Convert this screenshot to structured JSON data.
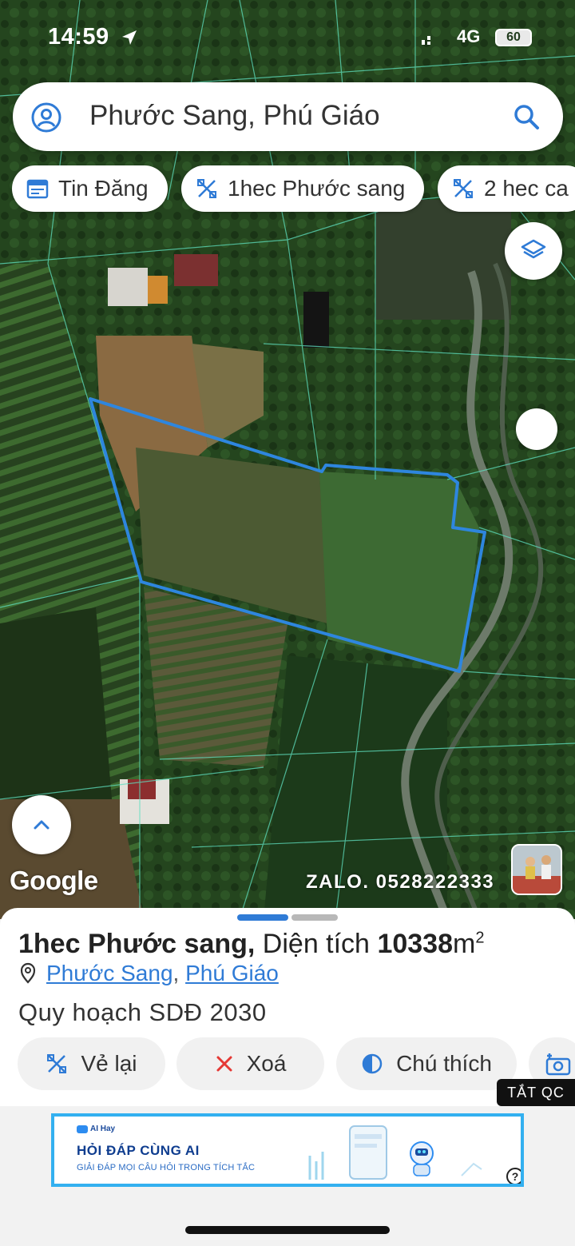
{
  "status_bar": {
    "time": "14:59",
    "network": "4G",
    "battery": "60"
  },
  "search": {
    "query": "Phước Sang, Phú Giáo"
  },
  "chips": [
    {
      "label": "Tin Đăng",
      "icon": "calendar-icon"
    },
    {
      "label": "1hec Phước sang",
      "icon": "draw-icon"
    },
    {
      "label": "2 hec ca",
      "icon": "draw-icon"
    }
  ],
  "map": {
    "attribution": "Google",
    "watermark": "ZALO. 0528222333",
    "polygon_color": "#2e86de"
  },
  "sheet": {
    "title_name": "1hec Phước sang,",
    "title_area_label": "Diện tích",
    "title_area_value": "10338",
    "title_area_unit": "m",
    "title_area_exp": "2",
    "location_commune": "Phước Sang",
    "location_separator": ",",
    "location_district": "Phú Giáo",
    "planning": "Quy hoạch SDĐ 2030"
  },
  "actions": [
    {
      "label": "Vẻ lại",
      "icon": "redraw-icon"
    },
    {
      "label": "Xoá",
      "icon": "close-icon"
    },
    {
      "label": "Chú thích",
      "icon": "legend-icon"
    }
  ],
  "ad": {
    "hide_label": "TẮT QC",
    "brand": "AI Hay",
    "headline": "HỎI ĐÁP CÙNG AI",
    "tagline": "GIẢI ĐÁP MỌI CÂU HỎI TRONG TÍCH TẮC",
    "help": "?"
  },
  "colors": {
    "accent": "#2f7bd6",
    "ad_border": "#33b0f0"
  }
}
